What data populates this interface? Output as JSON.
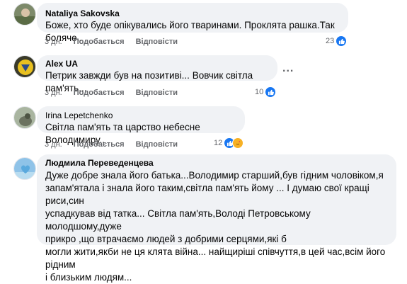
{
  "comments": [
    {
      "author": "Nataliya Sakovska",
      "text": "Боже, хто буде опікувались його тваринами. Проклята рашка.Так боляче..",
      "time": "3 дн.",
      "like": "Подобається",
      "reply": "Відповісти",
      "reactions": "23"
    },
    {
      "author": "Alex UA",
      "text": "Петрик завжди був на позитиві... Вовчик світла пам'ять...",
      "time": "3 дн.",
      "like": "Подобається",
      "reply": "Відповісти",
      "reactions": "10"
    },
    {
      "author": "Irina Lepetchenko",
      "text": "Світла пам'ять та царство небесне Володимиру..",
      "time": "3 дн.",
      "like": "Подобається",
      "reply": "Відповісти",
      "reactions": "12"
    },
    {
      "author": "Людмила Переведенцева",
      "text": "Дуже добре знала його батька...Володимир старший,був гідним чоловіком,я\nзапам'ятала і знала його таким,світла пам'ять йому ... І думаю свої кращі риси,син\nуспадкував від татка... Світла пам'ять,Володі Петровському молодшому,дуже\nприкро ,що втрачаємо людей з добрими серцями,які б\nмогли жити,якби не ця клята війна... найщиріші співчуття,в цей час,всім його рідним\nі близьким людям..."
    }
  ],
  "more_options": "...",
  "colors": {
    "bubble": "#f0f2f5",
    "like_blue": "#1877f2",
    "care_yellow": "#f7b125",
    "secondary_text": "#65676b"
  }
}
